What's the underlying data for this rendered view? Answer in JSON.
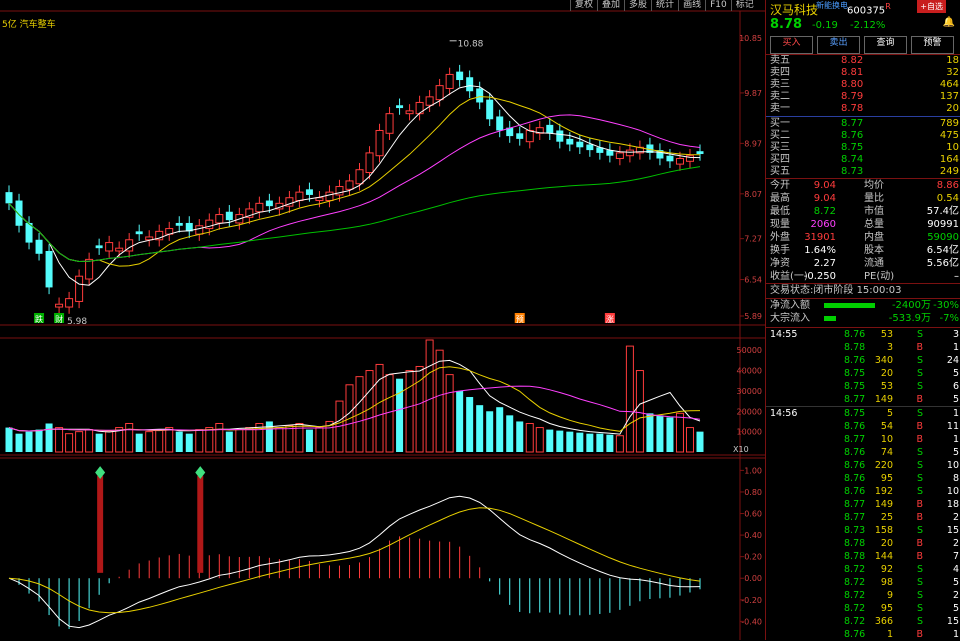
{
  "toolbar": [
    "复权",
    "叠加",
    "多股",
    "统计",
    "画线",
    "F10",
    "标记"
  ],
  "chart_top": {
    "left_text": "5亿 汽车整车",
    "high_label": "10.88",
    "low_label": "5.98"
  },
  "markers": [
    {
      "text": "跌",
      "i": 3
    },
    {
      "text": "财",
      "i": 5
    },
    {
      "text": "预",
      "i": 51
    },
    {
      "text": "涨",
      "i": 60
    }
  ],
  "price_axis": [
    "10.85",
    "9.87",
    "8.97",
    "8.07",
    "7.27",
    "6.54",
    "5.89"
  ],
  "vol_axis": [
    "50000",
    "40000",
    "30000",
    "20000",
    "10000"
  ],
  "vol_unit": "X10",
  "macd_axis": [
    "1.00",
    "0.80",
    "0.60",
    "0.40",
    "0.20",
    "0.00",
    "-0.20",
    "-0.40"
  ],
  "stock": {
    "name": "汉马科技",
    "tag": "新能换电",
    "code": "600375",
    "code_suffix": "R",
    "add_btn": "+自选",
    "price": "8.78",
    "change": "-0.19",
    "pct": "-2.12%",
    "bell": "🔔"
  },
  "actions": [
    "买入",
    "卖出",
    "查询",
    "预警"
  ],
  "asks": [
    {
      "label": "卖五",
      "price": "8.82",
      "vol": "18"
    },
    {
      "label": "卖四",
      "price": "8.81",
      "vol": "32"
    },
    {
      "label": "卖三",
      "price": "8.80",
      "vol": "464"
    },
    {
      "label": "卖二",
      "price": "8.79",
      "vol": "137"
    },
    {
      "label": "卖一",
      "price": "8.78",
      "vol": "20"
    }
  ],
  "bids": [
    {
      "label": "买一",
      "price": "8.77",
      "vol": "789"
    },
    {
      "label": "买二",
      "price": "8.76",
      "vol": "475"
    },
    {
      "label": "买三",
      "price": "8.75",
      "vol": "10"
    },
    {
      "label": "买四",
      "price": "8.74",
      "vol": "164"
    },
    {
      "label": "买五",
      "price": "8.73",
      "vol": "249"
    }
  ],
  "stats": [
    {
      "l1": "今开",
      "v1": "9.04",
      "c1": "red",
      "l2": "均价",
      "v2": "8.86",
      "c2": "red"
    },
    {
      "l1": "最高",
      "v1": "9.04",
      "c1": "red",
      "l2": "量比",
      "v2": "0.54",
      "c2": "yellow"
    },
    {
      "l1": "最低",
      "v1": "8.72",
      "c1": "green",
      "l2": "市值",
      "v2": "57.4亿",
      "c2": "white"
    },
    {
      "l1": "现量",
      "v1": "2060",
      "c1": "magenta",
      "l2": "总量",
      "v2": "90991",
      "c2": "white"
    },
    {
      "l1": "外盘",
      "v1": "31901",
      "c1": "red",
      "l2": "内盘",
      "v2": "59090",
      "c2": "green"
    },
    {
      "l1": "换手",
      "v1": "1.64%",
      "c1": "white",
      "l2": "股本",
      "v2": "6.54亿",
      "c2": "white"
    },
    {
      "l1": "净资",
      "v1": "2.27",
      "c1": "white",
      "l2": "流通",
      "v2": "5.56亿",
      "c2": "white"
    },
    {
      "l1": "收益(一)",
      "v1": "-0.250",
      "c1": "white",
      "l2": "PE(动)",
      "v2": "–",
      "c2": "white"
    }
  ],
  "status": {
    "label": "交易状态:",
    "value": "闭市阶段",
    "time": "15:00:03"
  },
  "flows": [
    {
      "label": "净流入额",
      "amount": "-2400万",
      "pct": "-30%",
      "fill": 0.85
    },
    {
      "label": "大宗流入",
      "amount": "-533.9万",
      "pct": "-7%",
      "fill": 0.2
    }
  ],
  "ticks": [
    {
      "t": "14:55",
      "p": "8.76",
      "v": "53",
      "d": "S",
      "n": "3"
    },
    {
      "t": "",
      "p": "8.78",
      "v": "3",
      "d": "B",
      "n": "1"
    },
    {
      "t": "",
      "p": "8.76",
      "v": "340",
      "d": "S",
      "n": "24"
    },
    {
      "t": "",
      "p": "8.75",
      "v": "20",
      "d": "S",
      "n": "5"
    },
    {
      "t": "",
      "p": "8.75",
      "v": "53",
      "d": "S",
      "n": "6"
    },
    {
      "t": "",
      "p": "8.77",
      "v": "149",
      "d": "B",
      "n": "5"
    },
    {
      "t": "14:56",
      "p": "8.75",
      "v": "5",
      "d": "S",
      "n": "1"
    },
    {
      "t": "",
      "p": "8.76",
      "v": "54",
      "d": "B",
      "n": "11"
    },
    {
      "t": "",
      "p": "8.77",
      "v": "10",
      "d": "B",
      "n": "1"
    },
    {
      "t": "",
      "p": "8.76",
      "v": "74",
      "d": "S",
      "n": "5"
    },
    {
      "t": "",
      "p": "8.76",
      "v": "220",
      "d": "S",
      "n": "10"
    },
    {
      "t": "",
      "p": "8.76",
      "v": "95",
      "d": "S",
      "n": "8"
    },
    {
      "t": "",
      "p": "8.76",
      "v": "192",
      "d": "S",
      "n": "10"
    },
    {
      "t": "",
      "p": "8.77",
      "v": "149",
      "d": "B",
      "n": "18"
    },
    {
      "t": "",
      "p": "8.77",
      "v": "25",
      "d": "B",
      "n": "2"
    },
    {
      "t": "",
      "p": "8.73",
      "v": "158",
      "d": "S",
      "n": "15"
    },
    {
      "t": "",
      "p": "8.78",
      "v": "20",
      "d": "B",
      "n": "2"
    },
    {
      "t": "",
      "p": "8.78",
      "v": "144",
      "d": "B",
      "n": "7"
    },
    {
      "t": "",
      "p": "8.72",
      "v": "92",
      "d": "S",
      "n": "4"
    },
    {
      "t": "",
      "p": "8.72",
      "v": "98",
      "d": "S",
      "n": "5"
    },
    {
      "t": "",
      "p": "8.72",
      "v": "9",
      "d": "S",
      "n": "2"
    },
    {
      "t": "",
      "p": "8.72",
      "v": "95",
      "d": "S",
      "n": "5"
    },
    {
      "t": "",
      "p": "8.72",
      "v": "366",
      "d": "S",
      "n": "15"
    },
    {
      "t": "",
      "p": "8.76",
      "v": "1",
      "d": "B",
      "n": "1"
    }
  ],
  "chart_data": {
    "type": "candlestick",
    "ylim": [
      5.89,
      10.85
    ],
    "vol_ylim": [
      0,
      55000
    ],
    "macd_ylim": [
      -0.48,
      1.05
    ],
    "closes": [
      7.9,
      7.5,
      7.2,
      7.0,
      6.4,
      6.1,
      6.2,
      6.6,
      6.9,
      7.1,
      7.2,
      7.1,
      7.25,
      7.35,
      7.3,
      7.4,
      7.45,
      7.5,
      7.4,
      7.5,
      7.6,
      7.7,
      7.6,
      7.7,
      7.8,
      7.9,
      7.85,
      7.9,
      8.0,
      8.1,
      8.05,
      8.0,
      8.1,
      8.2,
      8.3,
      8.5,
      8.8,
      9.2,
      9.5,
      9.6,
      9.55,
      9.7,
      9.8,
      10.0,
      10.2,
      10.1,
      9.9,
      9.7,
      9.4,
      9.2,
      9.1,
      9.05,
      9.2,
      9.25,
      9.15,
      9.0,
      8.95,
      8.9,
      8.85,
      8.8,
      8.75,
      8.8,
      8.85,
      8.9,
      8.8,
      8.7,
      8.65,
      8.7,
      8.75,
      8.78
    ],
    "volumes": [
      12000,
      9000,
      10000,
      11000,
      14000,
      12000,
      9000,
      10000,
      11000,
      9000,
      10000,
      12000,
      14000,
      9000,
      10000,
      11000,
      12000,
      10000,
      9000,
      11000,
      12000,
      14000,
      10000,
      11000,
      12000,
      14000,
      15000,
      12000,
      13000,
      14000,
      11000,
      12000,
      15000,
      25000,
      33000,
      37000,
      40000,
      43000,
      38000,
      36000,
      40000,
      42000,
      55000,
      50000,
      38000,
      30000,
      27000,
      23000,
      20000,
      22000,
      18000,
      15000,
      14000,
      12000,
      11000,
      10500,
      10000,
      9500,
      9000,
      9000,
      8500,
      8000,
      52000,
      40000,
      19000,
      18000,
      17000,
      19000,
      12000,
      10000
    ],
    "up": [
      0,
      0,
      0,
      0,
      0,
      1,
      1,
      1,
      1,
      0,
      1,
      1,
      1,
      0,
      1,
      1,
      1,
      0,
      0,
      1,
      1,
      1,
      0,
      1,
      1,
      1,
      0,
      1,
      1,
      1,
      0,
      1,
      1,
      1,
      1,
      1,
      1,
      1,
      1,
      0,
      1,
      1,
      1,
      1,
      1,
      0,
      0,
      0,
      0,
      0,
      0,
      0,
      1,
      1,
      0,
      0,
      0,
      0,
      0,
      0,
      0,
      1,
      1,
      1,
      0,
      0,
      0,
      1,
      1,
      0
    ]
  }
}
